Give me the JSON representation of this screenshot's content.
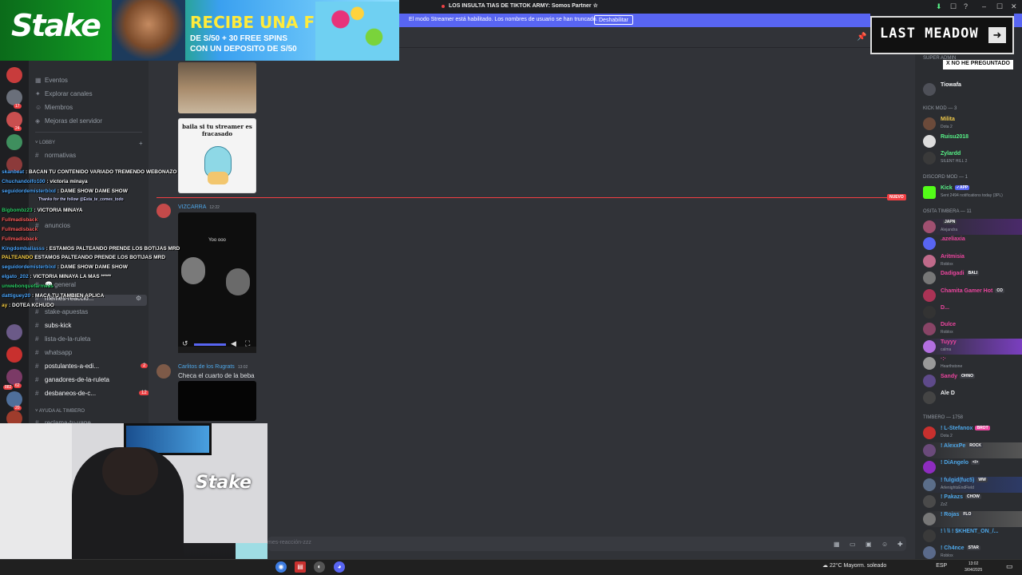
{
  "window": {
    "title": "LOS INSULTA TIAS DE TIKTOK ARMY: Somos Partner ☆",
    "controls": [
      "–",
      "☐",
      "✕"
    ]
  },
  "streamer_bar": {
    "text": "El modo Streamer está habilitado. Los nombres de usuario se han truncado.",
    "button": "Deshabilitar"
  },
  "ad": {
    "logo": "Stake",
    "headline": "RECIBE UNA FREEBET",
    "sub1": "DE S/50 + 30 FREE SPINS",
    "sub2": "CON UN DEPOSITO DE S/50"
  },
  "overlay_brand": {
    "last_meadow": "LAST MEADOW",
    "no_preguntado": "X NO HE PREGUNTADO"
  },
  "server_badges": [
    "17",
    "24",
    "62",
    "20",
    "882",
    "51",
    "348"
  ],
  "nav": [
    {
      "icon": "calendar-icon",
      "glyph": "▦",
      "label": "Eventos"
    },
    {
      "icon": "compass-icon",
      "glyph": "✦",
      "label": "Explorar canales"
    },
    {
      "icon": "members-icon",
      "glyph": "☺",
      "label": "Miembros"
    },
    {
      "icon": "shield-icon",
      "glyph": "◈",
      "label": "Mejoras del servidor"
    }
  ],
  "categories": {
    "lobby": "LOBBY",
    "ayuda": "AYUDA AL TIMBERO"
  },
  "channels": [
    {
      "label": "normativas",
      "emoji": ""
    },
    {
      "label": "anuncios",
      "emoji": "◀"
    },
    {
      "label": "💬 general",
      "emoji": ""
    },
    {
      "label": "memes-reaccio...",
      "emoji": ""
    },
    {
      "label": "stake-apuestas",
      "emoji": ""
    },
    {
      "label": "subs-kick",
      "emoji": ""
    },
    {
      "label": "lista-de-la-ruleta",
      "emoji": ""
    },
    {
      "label": "whatsapp",
      "emoji": ""
    },
    {
      "label": "postulantes-a-edi...",
      "emoji": "",
      "badge": "2"
    },
    {
      "label": "ganadores-de-la-ruleta",
      "emoji": ""
    },
    {
      "label": "desbaneos-de-c...",
      "emoji": "",
      "badge": "12"
    },
    {
      "label": "reclama-tu-vape",
      "emoji": ""
    }
  ],
  "chat_overlay": [
    {
      "user": "skanbeat",
      "msg": "BACAN TU CONTENIDO VARIADO TREMENDO WEBONAZO",
      "c": "b"
    },
    {
      "user": "Chuchandolfo100",
      "msg": "victoria minaya",
      "c": "b"
    },
    {
      "user": "seguidordemisterbixd",
      "msg": "DAME SHOW DAME SHOW",
      "c": "b"
    },
    {
      "user": "Bigbombz23",
      "msg": "VICTORIA MINAYA",
      "c": "g"
    },
    {
      "user": "Fullmadisback",
      "msg": "",
      "c": "r"
    },
    {
      "user": "Fullmadisback",
      "msg": "",
      "c": "r"
    },
    {
      "user": "Fullmadisback",
      "msg": "",
      "c": "r"
    },
    {
      "user": "Kingdombaliasss",
      "msg": "ESTAMOS PALTEANDO PRENDE LOS BOTIJAS MRD",
      "c": "b"
    },
    {
      "user": "PALTEANDO",
      "msg": "ESTAMOS PALTEANDO PRENDE LOS BOTIJAS MRD",
      "c": "y"
    },
    {
      "user": "seguidordemisterbixd",
      "msg": "DAME SHOW DAME SHOW",
      "c": "b"
    },
    {
      "user": "elgato_202",
      "msg": "VICTORIA MINAYA LA MAS *****",
      "c": "b"
    },
    {
      "user": "unwebonquefarmeas",
      "msg": "",
      "c": "g"
    },
    {
      "user": "dattiguey20",
      "msg": "MACA TU TAMBIEN APLICA",
      "c": "b"
    },
    {
      "user": "ay",
      "msg": "DOTEA KCHUDO",
      "c": "y"
    }
  ],
  "chat_overlay_small": "Thanks for the follow @Esta_te_comes_todo",
  "messages": {
    "meme_text": "baila si tu streamer es fracasado",
    "author1": "VIZCARRA",
    "time1": "12:22",
    "video_title": "Yoo ooo",
    "author2": "Carlitos de los Rugrats",
    "time2": "13:02",
    "text2": "Checa el cuarto de la beba",
    "new_label": "NUEVO"
  },
  "members": {
    "cat_super": "SUPER ADMIN",
    "cat_kick": "KICK MOD — 3",
    "cat_discord": "DISCORD MOD — 1",
    "cat_osita": "OSITA TIMBERA — 11",
    "cat_timbero": "TIMBERO — 1758",
    "list": [
      {
        "name": "Tiowafa",
        "sub": "",
        "color": "#f2f3f5",
        "tag": ""
      },
      {
        "name": "Milita",
        "sub": "Dota 2",
        "color": "#f0c94a",
        "tag": ""
      },
      {
        "name": "Ruisu2018",
        "sub": "",
        "color": "#57f287",
        "tag": ""
      },
      {
        "name": "Zylardd",
        "sub": "SILENT HILL 2",
        "color": "#57f287",
        "tag": ""
      },
      {
        "name": "Kick",
        "sub": "Sent 2494 notifications today (3PL)",
        "color": "#57f287",
        "tag": "✓APP"
      },
      {
        "name": "",
        "sub": "Alejandra",
        "color": "#eb459e",
        "tag": "JAPN"
      },
      {
        "name": ".azeliaxia",
        "sub": "",
        "color": "#eb459e",
        "tag": ""
      },
      {
        "name": "Aritmisia",
        "sub": "Roblox",
        "color": "#eb459e",
        "tag": ""
      },
      {
        "name": "Dadigadi",
        "sub": "",
        "color": "#eb459e",
        "tag": "BALI"
      },
      {
        "name": "Chamita Gamer Hot",
        "sub": "",
        "color": "#eb459e",
        "tag": "CO"
      },
      {
        "name": "D...",
        "sub": "",
        "color": "#eb459e",
        "tag": ""
      },
      {
        "name": "Dulce",
        "sub": "Roblox",
        "color": "#eb459e",
        "tag": ""
      },
      {
        "name": "Tuyyy",
        "sub": "calma",
        "color": "#eb459e",
        "tag": ""
      },
      {
        "name": "·:·",
        "sub": "Hearthstone",
        "color": "#eb459e",
        "tag": ""
      },
      {
        "name": "Sandy",
        "sub": "",
        "color": "#eb459e",
        "tag": "OHNO"
      },
      {
        "name": "Ale D",
        "sub": "",
        "color": "#f2f3f5",
        "tag": ""
      },
      {
        "name": "! L-Stefanox",
        "sub": "Dota 2",
        "color": "#4ea7e8",
        "tag": "BROT"
      },
      {
        "name": "! AlexxPe",
        "sub": "",
        "color": "#4ea7e8",
        "tag": "ROCK"
      },
      {
        "name": "! DiAngelo",
        "sub": "",
        "color": "#4ea7e8",
        "tag": "</>"
      },
      {
        "name": "! fulgid(fuc5)",
        "sub": "ArlenightsEndField",
        "color": "#4ea7e8",
        "tag": "WW"
      },
      {
        "name": "! Pakazs",
        "sub": "ZzZ",
        "color": "#4ea7e8",
        "tag": "CHOW"
      },
      {
        "name": "! Rojas",
        "sub": "",
        "color": "#4ea7e8",
        "tag": "FLO"
      },
      {
        "name": "! \\ \\\\ ! $KHENT_ON_/...",
        "sub": "",
        "color": "#4ea7e8",
        "tag": ""
      },
      {
        "name": "! Ch4nce",
        "sub": "Roblox",
        "color": "#4ea7e8",
        "tag": "STAR"
      }
    ]
  },
  "input": {
    "placeholder": "mes-reacción-zzz"
  },
  "taskbar": {
    "weather": "22°C  Mayorm. soleado",
    "lang": "ESP",
    "time": "13:02",
    "date": "3/04/2025"
  }
}
